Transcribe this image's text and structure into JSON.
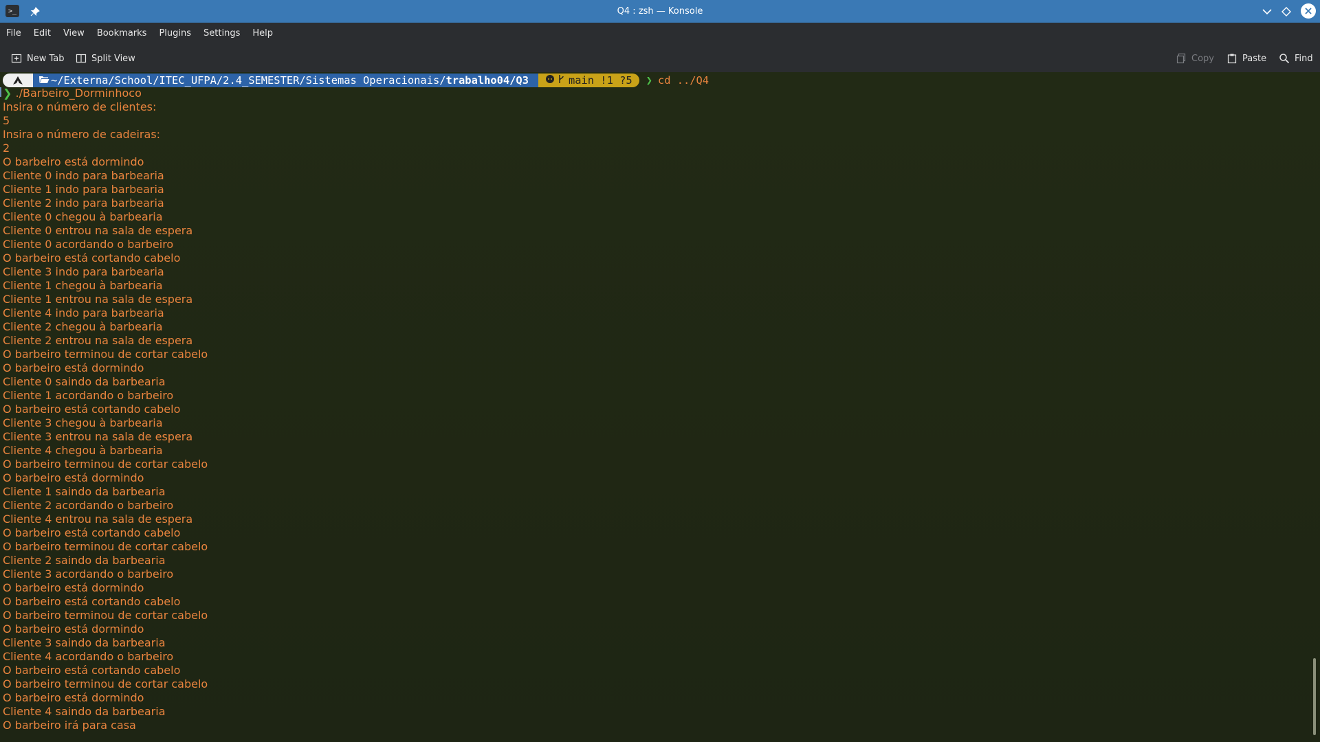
{
  "window": {
    "title": "Q4 : zsh — Konsole"
  },
  "menu": [
    "File",
    "Edit",
    "View",
    "Bookmarks",
    "Plugins",
    "Settings",
    "Help"
  ],
  "toolbar": {
    "new_tab": "New Tab",
    "split_view": "Split View",
    "copy": "Copy",
    "paste": "Paste",
    "find": "Find"
  },
  "prompt": {
    "path_prefix": "~/Externa/School/ITEC_UFPA/2.4_SEMESTER/Sistemas Operacionais/",
    "path_current": "trabalho04/Q3",
    "git": "main !1 ?5",
    "command": "cd ../Q4"
  },
  "terminal": {
    "lines": [
      "❯ ./Barbeiro_Dorminhoco",
      "Insira o número de clientes:",
      "5",
      "Insira o número de cadeiras:",
      "2",
      "O barbeiro está dormindo",
      "Cliente 0 indo para barbearia",
      "Cliente 1 indo para barbearia",
      "Cliente 2 indo para barbearia",
      "Cliente 0 chegou à barbearia",
      "Cliente 0 entrou na sala de espera",
      "Cliente 0 acordando o barbeiro",
      "O barbeiro está cortando cabelo",
      "Cliente 3 indo para barbearia",
      "Cliente 1 chegou à barbearia",
      "Cliente 1 entrou na sala de espera",
      "Cliente 4 indo para barbearia",
      "Cliente 2 chegou à barbearia",
      "Cliente 2 entrou na sala de espera",
      "O barbeiro terminou de cortar cabelo",
      "O barbeiro está dormindo",
      "Cliente 0 saindo da barbearia",
      "Cliente 1 acordando o barbeiro",
      "O barbeiro está cortando cabelo",
      "Cliente 3 chegou à barbearia",
      "Cliente 3 entrou na sala de espera",
      "Cliente 4 chegou à barbearia",
      "O barbeiro terminou de cortar cabelo",
      "O barbeiro está dormindo",
      "Cliente 1 saindo da barbearia",
      "Cliente 2 acordando o barbeiro",
      "Cliente 4 entrou na sala de espera",
      "O barbeiro está cortando cabelo",
      "O barbeiro terminou de cortar cabelo",
      "Cliente 2 saindo da barbearia",
      "Cliente 3 acordando o barbeiro",
      "O barbeiro está dormindo",
      "O barbeiro está cortando cabelo",
      "O barbeiro terminou de cortar cabelo",
      "O barbeiro está dormindo",
      "Cliente 3 saindo da barbearia",
      "Cliente 4 acordando o barbeiro",
      "O barbeiro está cortando cabelo",
      "O barbeiro terminou de cortar cabelo",
      "O barbeiro está dormindo",
      "Cliente 4 saindo da barbearia",
      "O barbeiro irá para casa"
    ]
  },
  "colors": {
    "titlebar": "#3a79b5",
    "output_text": "#e9843e",
    "prompt_path_bg": "#2d63a8",
    "prompt_git_bg": "#c9a218",
    "prompt_chevron": "#4ec24a"
  }
}
